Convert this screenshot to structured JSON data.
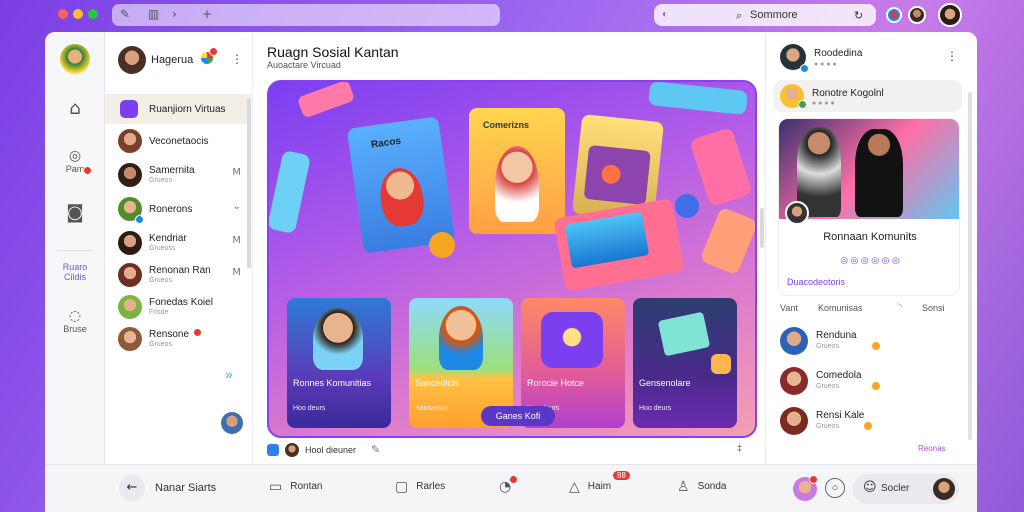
{
  "browser": {
    "search_text": "Sommore"
  },
  "rail": {
    "items": [
      {
        "icon": "home-icon",
        "glyph": "⌂",
        "label": ""
      },
      {
        "icon": "people-icon",
        "glyph": "◎",
        "label": "Pam"
      },
      {
        "icon": "camera-icon",
        "glyph": "◙",
        "label": ""
      },
      {
        "icon": "community-icon",
        "glyph": "",
        "label": "Ruaro Cildis"
      },
      {
        "icon": "chat-icon",
        "glyph": "◌",
        "label": "Bruse"
      }
    ]
  },
  "chat_list": {
    "header_name": "Hagerua",
    "active_item": "Ruanjiorn Virtuas",
    "items": [
      {
        "name": "Veconetaocis",
        "sub": ""
      },
      {
        "name": "Samernita",
        "sub": "Grueos",
        "time": "M"
      },
      {
        "name": "Ronerons",
        "sub": "",
        "time": "⌄"
      },
      {
        "name": "Kendriar",
        "sub": "Grueoss",
        "time": "M"
      },
      {
        "name": "Renonan Ran",
        "sub": "Grueos",
        "time": "M"
      },
      {
        "name": "Fonedas Koiel",
        "sub": "Frisde",
        "time": ""
      },
      {
        "name": "Rensone",
        "sub": "Grueos",
        "time": ""
      }
    ],
    "expand": "»"
  },
  "center": {
    "title": "Ruagn Sosial Kantan",
    "subtitle": "Auoactare Vircuad",
    "hero_cards": [
      "Racos",
      "Comerizns"
    ],
    "tiles": [
      {
        "label": "Ronnes Komunitias",
        "sub": "Hoo deurs"
      },
      {
        "label": "Sancedicis",
        "sub": "Sansamuc"
      },
      {
        "label": "Rorocie Hotce",
        "sub": "Hoo deurs"
      },
      {
        "label": "Gensenolare",
        "sub": "Hoo deurs"
      }
    ],
    "hero_button": "Ganes Kofi",
    "footer_text": "Hool dieuner",
    "footer_right": "‡"
  },
  "right_panel": {
    "top_user": {
      "name": "Roodedina",
      "sub": "● ● ● ●"
    },
    "second_user": {
      "name": "Ronotre Kogolnl",
      "sub": "● ● ● ●"
    },
    "card_title": "Ronnaan Komunits",
    "card_sub": "◎ ◎ ◎ ◎ ◎ ◎",
    "card_link": "Duacodeotoris",
    "tabs": [
      "Vant",
      "Komunisas",
      "Sonsi"
    ],
    "members": [
      {
        "name": "Renduna",
        "sub": "Grueos"
      },
      {
        "name": "Comedola",
        "sub": "Grueos"
      },
      {
        "name": "Rensi Kale",
        "sub": "Grueos"
      }
    ],
    "more_link": "Reonas"
  },
  "bottom_bar": {
    "items": [
      {
        "icon": "back-icon",
        "glyph": "←",
        "label": "Nanar Siarts"
      },
      {
        "icon": "comment-icon",
        "glyph": "▭",
        "label": "Rontan"
      },
      {
        "icon": "reply-icon",
        "glyph": "▢",
        "label": "Rarles"
      },
      {
        "icon": "bell-icon",
        "glyph": "◔",
        "label": ""
      },
      {
        "icon": "compass-icon",
        "glyph": "△",
        "label": "Haim"
      },
      {
        "icon": "profile-icon",
        "glyph": "♙",
        "label": "Sonda"
      },
      {
        "icon": "smile-icon",
        "glyph": "☺",
        "label": "Socler"
      }
    ],
    "badge_text": "88"
  }
}
